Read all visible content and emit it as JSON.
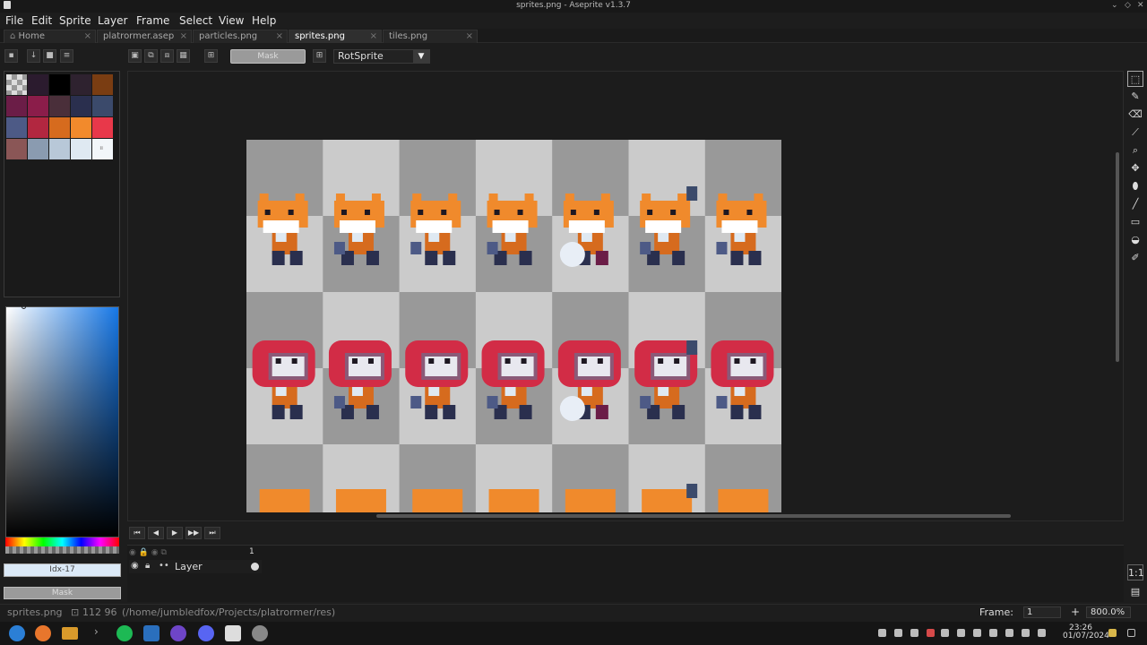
{
  "window": {
    "title": "sprites.png - Aseprite v1.3.7"
  },
  "menu": [
    "File",
    "Edit",
    "Sprite",
    "Layer",
    "Frame",
    "Select",
    "View",
    "Help"
  ],
  "tabs": [
    {
      "label": "Home",
      "active": false
    },
    {
      "label": "platrormer.asep",
      "active": false
    },
    {
      "label": "particles.png",
      "active": false
    },
    {
      "label": "sprites.png",
      "active": true
    },
    {
      "label": "tiles.png",
      "active": false
    }
  ],
  "toolbar": {
    "mask_label": "Mask",
    "rotation_algorithm": "RotSprite"
  },
  "palette": {
    "colors": [
      "#2b1b2e",
      "#000000",
      "#2e222f",
      "#7a3d12",
      "#6b1d47",
      "#8b1d4a",
      "#4a2f3a",
      "#2a2f4e",
      "#3b4a6b",
      "#4d5a86",
      "#b22740",
      "#d66b1e",
      "#f28a2c",
      "#e8384a",
      "#8a5656",
      "#8a9bb0",
      "#b8c8d8",
      "#dfe9f2",
      "#f2f6f9"
    ],
    "color_index_label": "Idx-17",
    "mask_label": "Mask"
  },
  "timeline": {
    "frame_number": "1",
    "layer_name": "Layer"
  },
  "status": {
    "file": "sprites.png",
    "coords": "112 96",
    "path": "(/home/jumbledfox/Projects/platrormer/res)",
    "frame_label": "Frame:",
    "frame_value": "1",
    "zoom": "800.0%"
  },
  "clock": {
    "time": "23:26",
    "date": "01/07/2024"
  },
  "sprite_sheet": {
    "fox_row": {
      "columns": 7,
      "has_helmet": false
    },
    "helmet_row": {
      "columns": 7,
      "has_helmet": true
    }
  }
}
